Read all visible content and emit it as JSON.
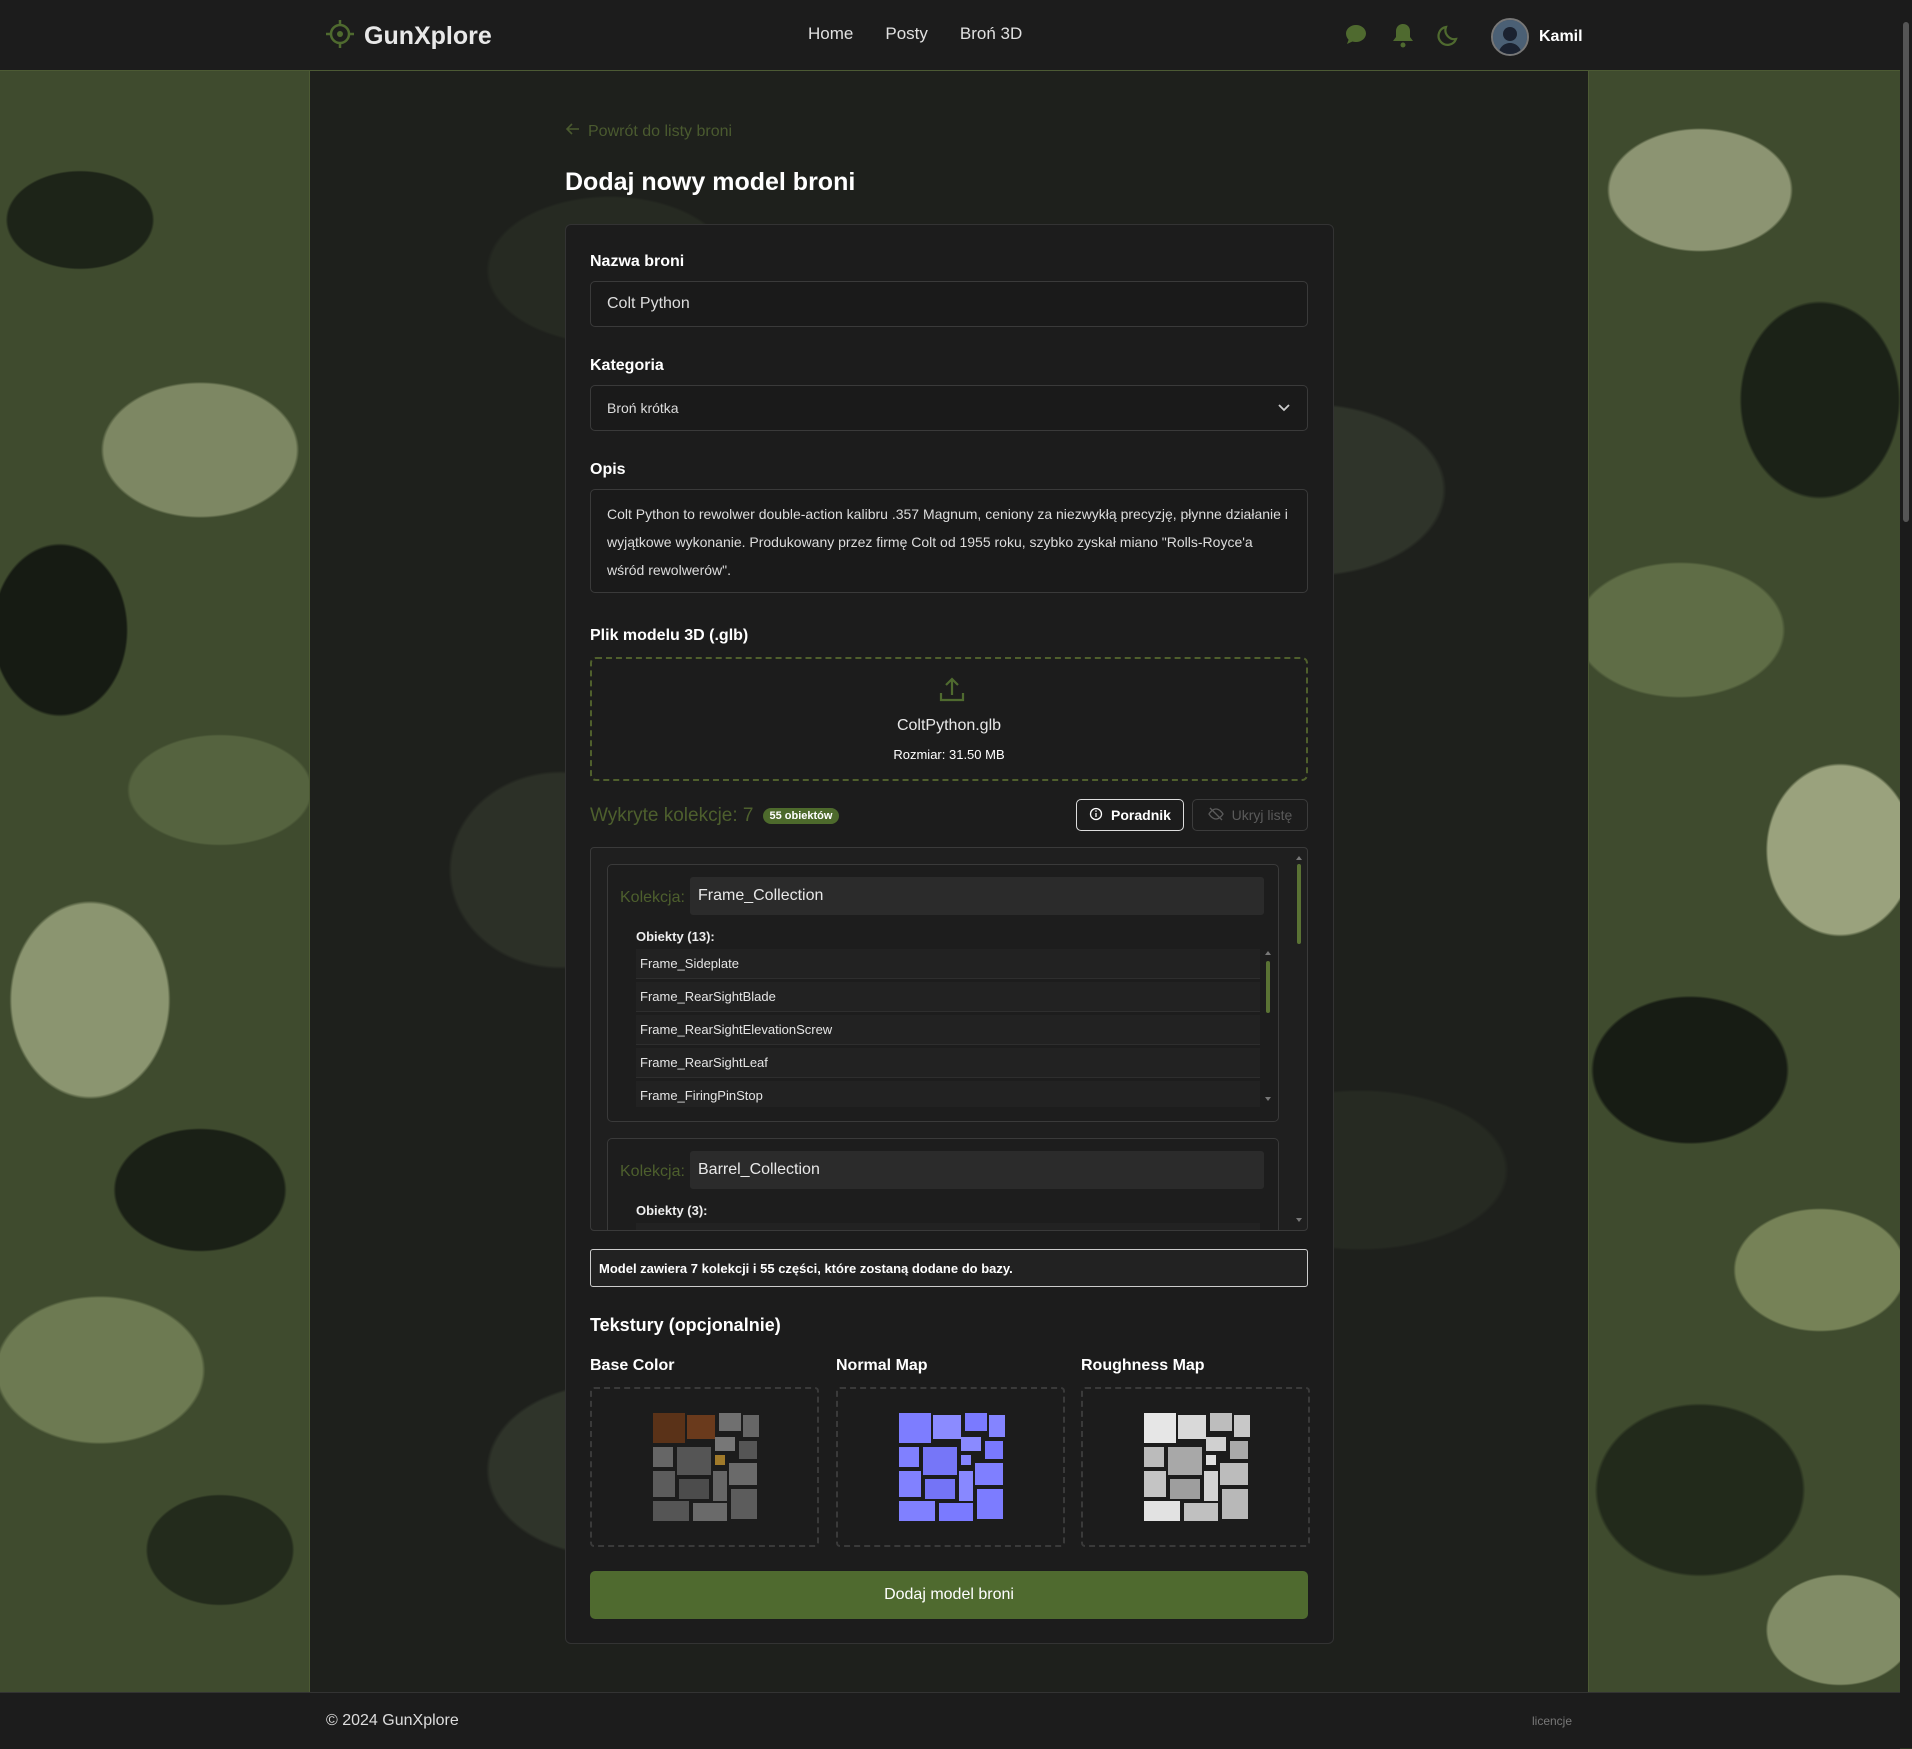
{
  "header": {
    "logo_text": "GunXplore",
    "nav": [
      "Home",
      "Posty",
      "Broń 3D"
    ],
    "user_name": "Kamil",
    "icons": [
      "chat-icon",
      "bell-icon",
      "moon-icon"
    ]
  },
  "back_link": "Powrót do listy broni",
  "page_title": "Dodaj nowy model broni",
  "form": {
    "name_label": "Nazwa broni",
    "name_value": "Colt Python",
    "category_label": "Kategoria",
    "category_value": "Broń krótka",
    "description_label": "Opis",
    "description_value": "Colt Python to rewolwer double-action kalibru .357 Magnum, ceniony za niezwykłą precyzję, płynne działanie i wyjątkowe wykonanie. Produkowany przez firmę Colt od 1955 roku, szybko zyskał miano \"Rolls-Royce'a wśród rewolwerów\".",
    "model_label": "Plik modelu 3D (.glb)",
    "file_name": "ColtPython.glb",
    "file_size": "Rozmiar: 31.50 MB"
  },
  "collections": {
    "detected_label": "Wykryte kolekcje: 7",
    "objects_badge": "55 obiektów",
    "guide_button": "Poradnik",
    "hide_button": "Ukryj listę",
    "items": [
      {
        "label": "Kolekcja:",
        "name": "Frame_Collection",
        "objects_label": "Obiekty (13):",
        "objects": [
          "Frame_Sideplate",
          "Frame_RearSightBlade",
          "Frame_RearSightElevationScrew",
          "Frame_RearSightLeaf",
          "Frame_FiringPinStop"
        ]
      },
      {
        "label": "Kolekcja:",
        "name": "Barrel_Collection",
        "objects_label": "Obiekty (3):",
        "objects": []
      }
    ],
    "summary": "Model zawiera 7 kolekcji i 55 części, które zostaną dodane do bazy."
  },
  "textures": {
    "title": "Tekstury (opcjonalnie)",
    "slots": [
      {
        "label": "Base Color",
        "color": "#5c5c5c",
        "accent": "#5a3218"
      },
      {
        "label": "Normal Map",
        "color": "#7d7dff",
        "accent": "#8b8bff"
      },
      {
        "label": "Roughness Map",
        "color": "#bdbdbd",
        "accent": "#e6e6e6"
      }
    ]
  },
  "submit_label": "Dodaj model broni",
  "footer": {
    "copyright": "© 2024 GunXplore",
    "license_link": "licencje"
  },
  "colors": {
    "accent": "#4f6a2f",
    "accent_text": "#4d5f2d"
  }
}
